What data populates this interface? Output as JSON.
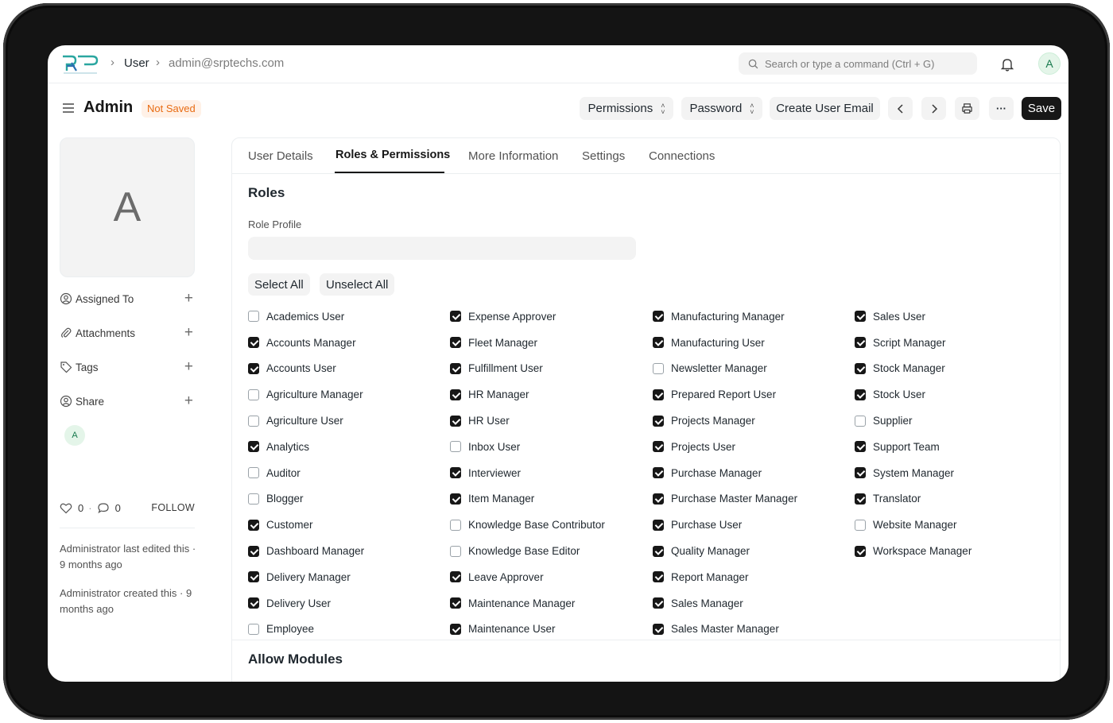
{
  "breadcrumb": {
    "doctype": "User",
    "record": "admin@srptechs.com"
  },
  "search": {
    "placeholder": "Search or type a command (Ctrl + G)"
  },
  "user_avatar_letter": "A",
  "page": {
    "title": "Admin",
    "status": "Not Saved"
  },
  "toolbar": {
    "permissions": "Permissions",
    "password": "Password",
    "create_user_email": "Create User Email",
    "more": "···",
    "save": "Save"
  },
  "sidebar": {
    "avatar_letter": "A",
    "assigned_to": "Assigned To",
    "attachments": "Attachments",
    "tags": "Tags",
    "share": "Share",
    "shared_avatar": "A",
    "likes": "0",
    "comments": "0",
    "follow": "FOLLOW",
    "last_edited": "Administrator last edited this · 9 months ago",
    "created": "Administrator created this · 9 months ago"
  },
  "tabs": [
    "User Details",
    "Roles & Permissions",
    "More Information",
    "Settings",
    "Connections"
  ],
  "roles_section": {
    "title": "Roles",
    "role_profile_label": "Role Profile",
    "select_all": "Select All",
    "unselect_all": "Unselect All"
  },
  "roles": [
    [
      {
        "name": "Academics User",
        "checked": false
      },
      {
        "name": "Accounts Manager",
        "checked": true
      },
      {
        "name": "Accounts User",
        "checked": true
      },
      {
        "name": "Agriculture Manager",
        "checked": false
      },
      {
        "name": "Agriculture User",
        "checked": false
      },
      {
        "name": "Analytics",
        "checked": true
      },
      {
        "name": "Auditor",
        "checked": false
      },
      {
        "name": "Blogger",
        "checked": false
      },
      {
        "name": "Customer",
        "checked": true
      },
      {
        "name": "Dashboard Manager",
        "checked": true
      },
      {
        "name": "Delivery Manager",
        "checked": true
      },
      {
        "name": "Delivery User",
        "checked": true
      },
      {
        "name": "Employee",
        "checked": false
      }
    ],
    [
      {
        "name": "Expense Approver",
        "checked": true
      },
      {
        "name": "Fleet Manager",
        "checked": true
      },
      {
        "name": "Fulfillment User",
        "checked": true
      },
      {
        "name": "HR Manager",
        "checked": true
      },
      {
        "name": "HR User",
        "checked": true
      },
      {
        "name": "Inbox User",
        "checked": false
      },
      {
        "name": "Interviewer",
        "checked": true
      },
      {
        "name": "Item Manager",
        "checked": true
      },
      {
        "name": "Knowledge Base Contributor",
        "checked": false
      },
      {
        "name": "Knowledge Base Editor",
        "checked": false
      },
      {
        "name": "Leave Approver",
        "checked": true
      },
      {
        "name": "Maintenance Manager",
        "checked": true
      },
      {
        "name": "Maintenance User",
        "checked": true
      }
    ],
    [
      {
        "name": "Manufacturing Manager",
        "checked": true
      },
      {
        "name": "Manufacturing User",
        "checked": true
      },
      {
        "name": "Newsletter Manager",
        "checked": false
      },
      {
        "name": "Prepared Report User",
        "checked": true
      },
      {
        "name": "Projects Manager",
        "checked": true
      },
      {
        "name": "Projects User",
        "checked": true
      },
      {
        "name": "Purchase Manager",
        "checked": true
      },
      {
        "name": "Purchase Master Manager",
        "checked": true
      },
      {
        "name": "Purchase User",
        "checked": true
      },
      {
        "name": "Quality Manager",
        "checked": true
      },
      {
        "name": "Report Manager",
        "checked": true
      },
      {
        "name": "Sales Manager",
        "checked": true
      },
      {
        "name": "Sales Master Manager",
        "checked": true
      }
    ],
    [
      {
        "name": "Sales User",
        "checked": true
      },
      {
        "name": "Script Manager",
        "checked": true
      },
      {
        "name": "Stock Manager",
        "checked": true
      },
      {
        "name": "Stock User",
        "checked": true
      },
      {
        "name": "Supplier",
        "checked": false
      },
      {
        "name": "Support Team",
        "checked": true
      },
      {
        "name": "System Manager",
        "checked": true
      },
      {
        "name": "Translator",
        "checked": true
      },
      {
        "name": "Website Manager",
        "checked": false
      },
      {
        "name": "Workspace Manager",
        "checked": true
      }
    ]
  ],
  "modules_section": {
    "title": "Allow Modules"
  },
  "colors": {
    "accent": "#171717",
    "status_orange": "#e86c13",
    "avatar_green": "#16794c"
  }
}
